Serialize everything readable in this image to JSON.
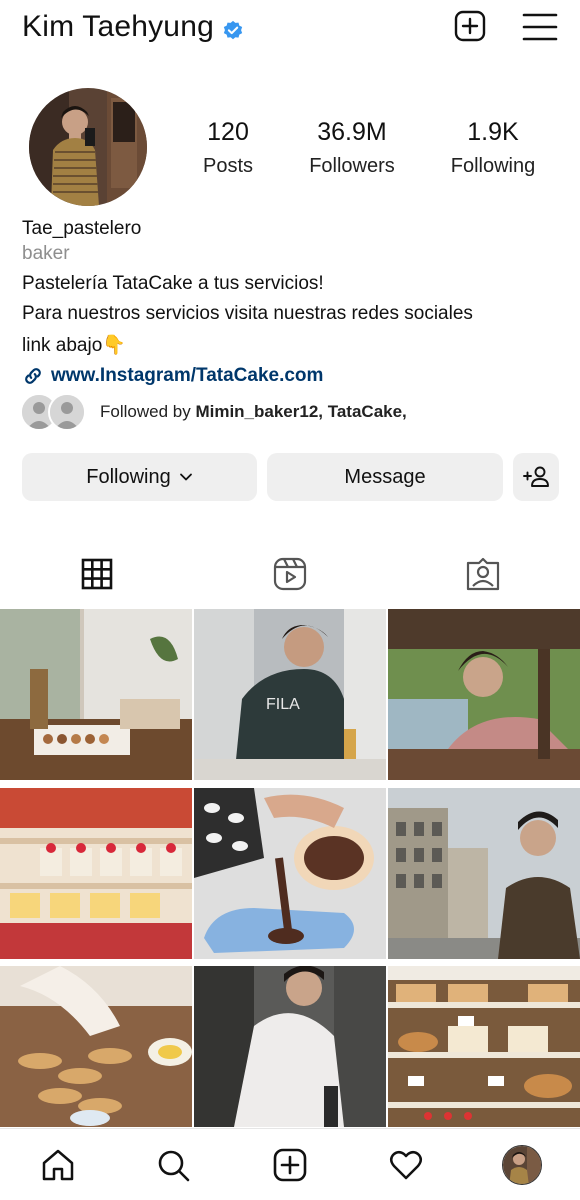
{
  "header": {
    "username": "Kim Taehyung",
    "verified_icon": "verified-badge-icon",
    "new_post_icon": "plus-square-icon",
    "menu_icon": "hamburger-menu-icon"
  },
  "stats": {
    "posts_count": "120",
    "posts_label": "Posts",
    "followers_count": "36.9M",
    "followers_label": "Followers",
    "following_count": "1.9K",
    "following_label": "Following"
  },
  "bio": {
    "name": "Tae_pastelero",
    "category": "baker",
    "line1": "Pastelería TataCake a tus servicios!",
    "line2": "Para nuestros servicios visita nuestras redes sociales",
    "line3": "link abajo",
    "line3_emoji": "👇",
    "link": "www.Instagram/TataCake.com"
  },
  "followed_by": {
    "prefix": "Followed by ",
    "names": "Mimin_baker12, TataCake,"
  },
  "buttons": {
    "following": "Following",
    "message": "Message"
  },
  "tabs": [
    "grid-icon",
    "reels-icon",
    "tagged-icon"
  ],
  "bottom_nav": [
    "home-icon",
    "search-icon",
    "create-icon",
    "heart-icon",
    "profile-avatar"
  ],
  "colors": {
    "verified": "#3897f0",
    "link": "#00376b",
    "button_bg": "#efefef",
    "muted": "#8e8e8e"
  }
}
